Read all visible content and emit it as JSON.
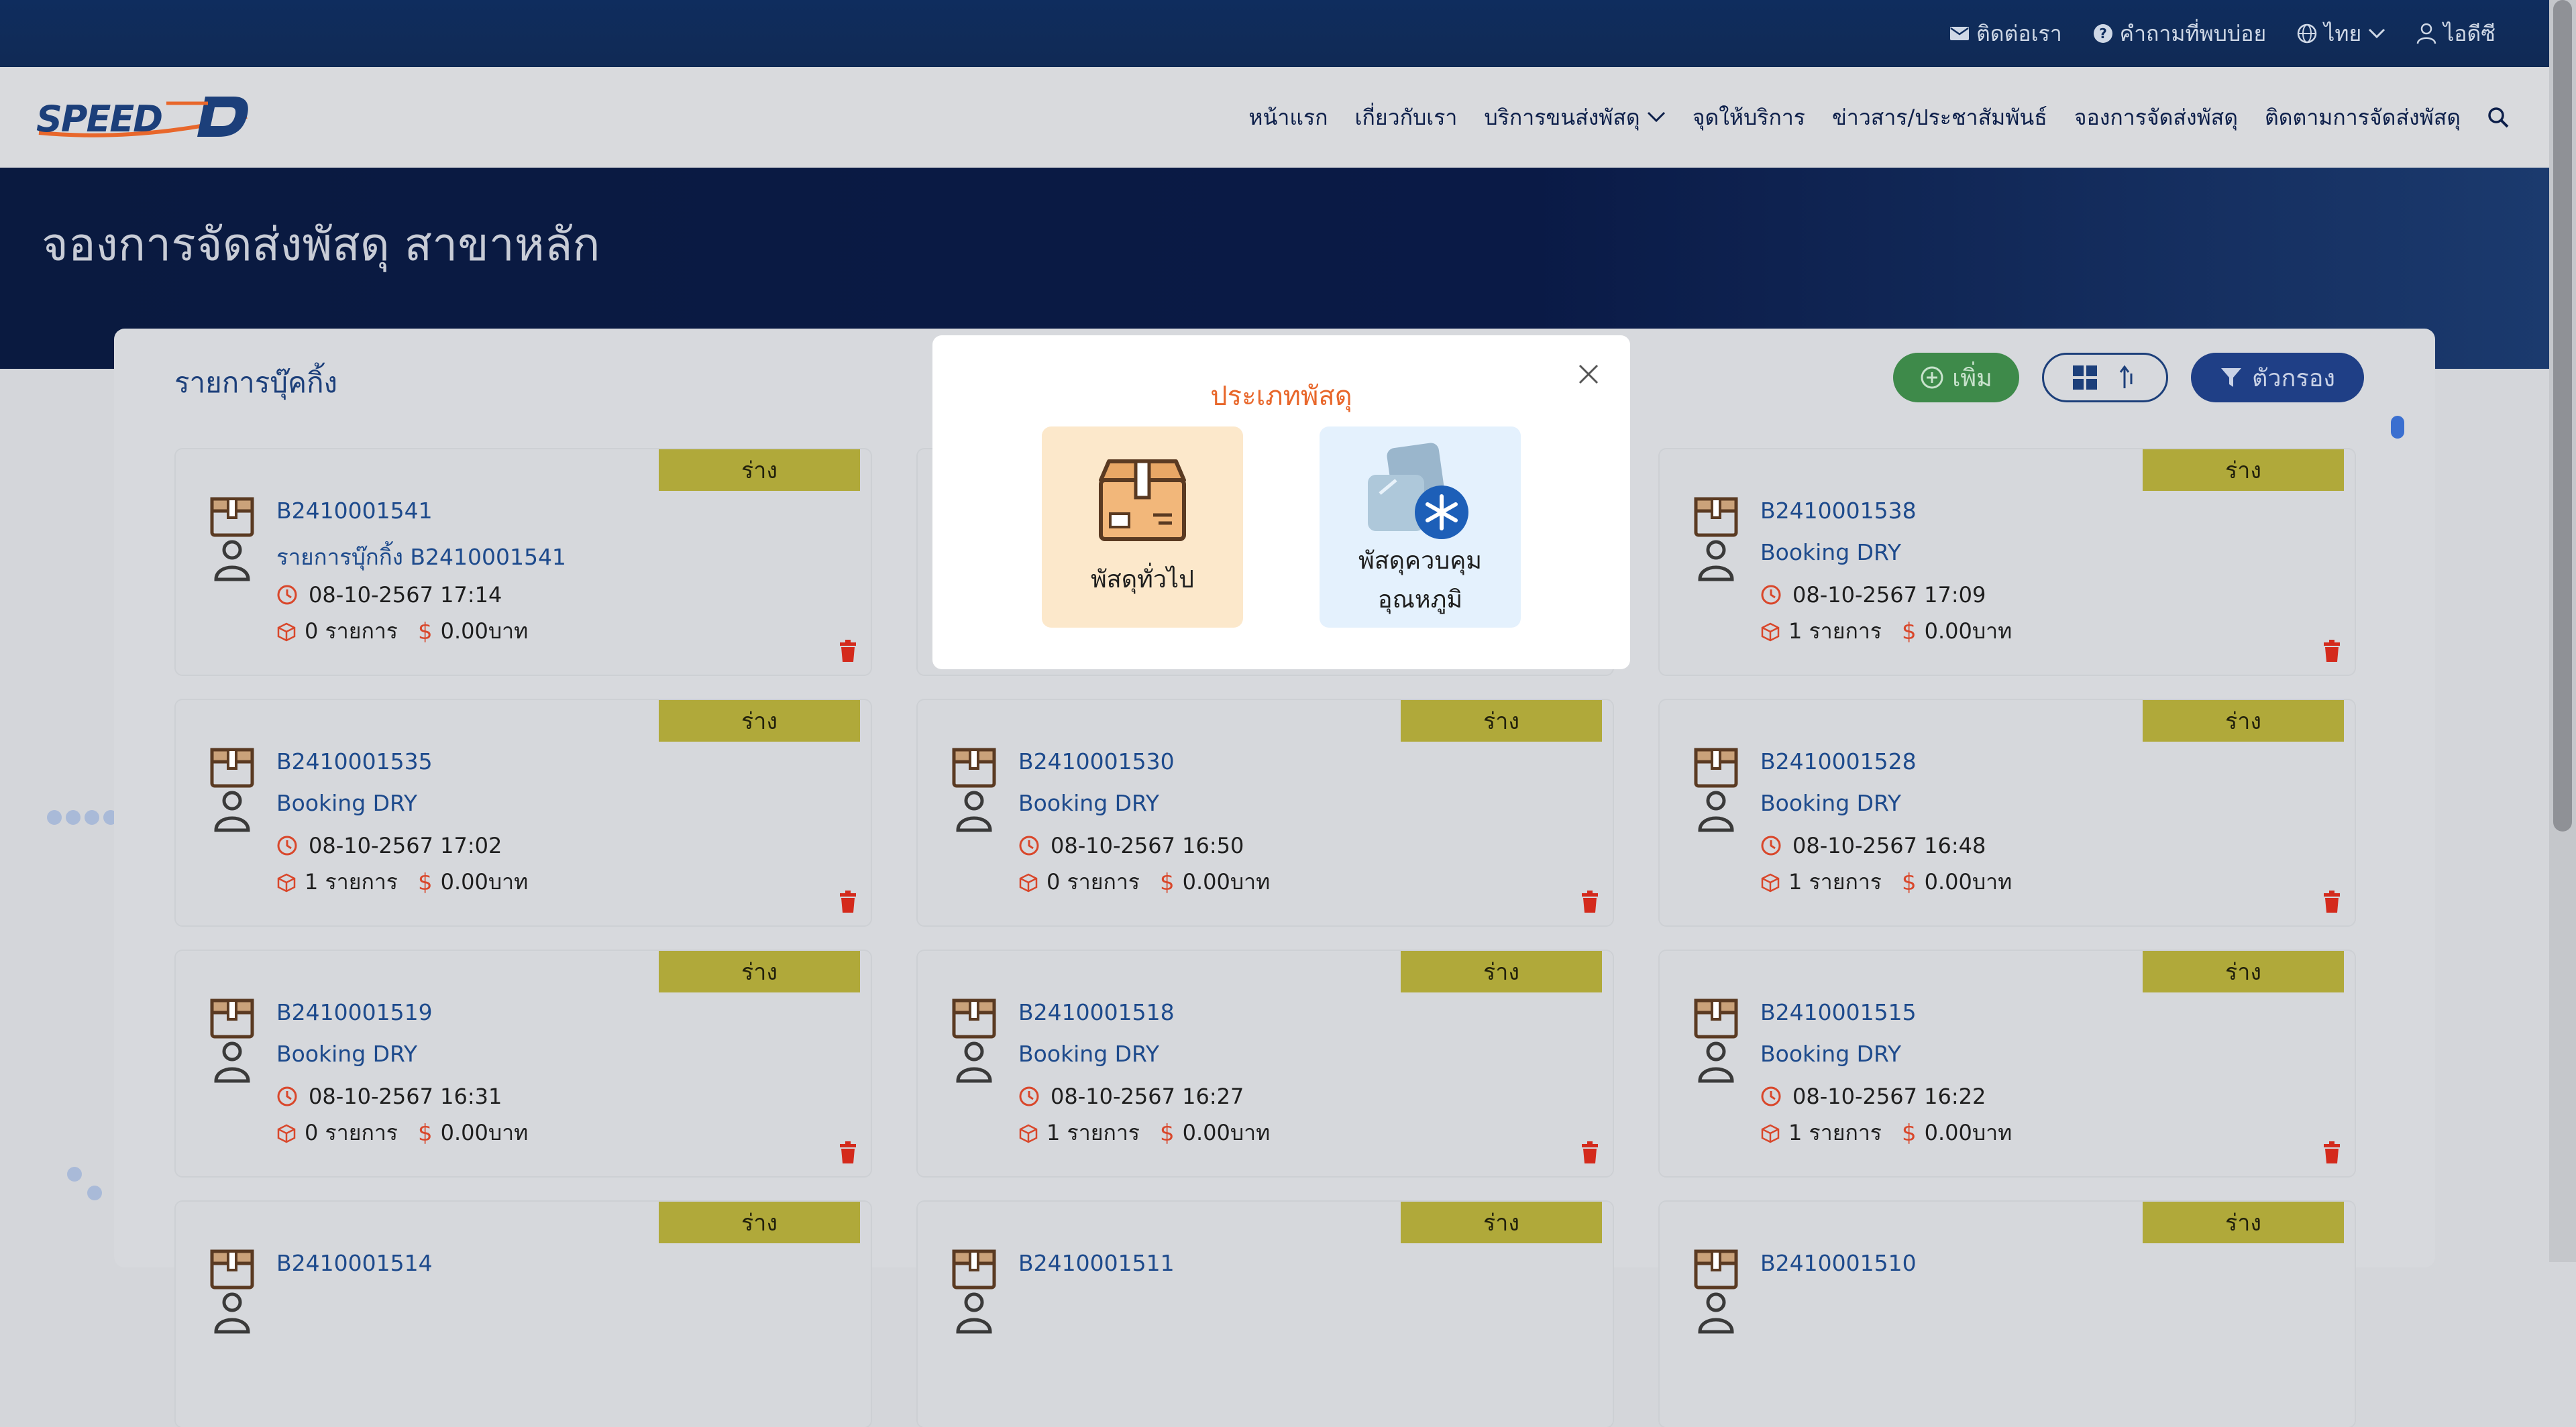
{
  "topbar": {
    "contact": "ติดต่อเรา",
    "faq": "คำถามที่พบบ่อย",
    "language": "ไทย",
    "user": "ไอดีซี"
  },
  "nav": {
    "items": [
      "หน้าแรก",
      "เกี่ยวกับเรา",
      "บริการขนส่งพัสดุ",
      "จุดให้บริการ",
      "ข่าวสาร/ประชาสัมพันธ์",
      "จองการจัดส่งพัสดุ",
      "ติดตามการจัดส่งพัสดุ"
    ]
  },
  "hero": {
    "title": "จองการจัดส่งพัสดุ สาขาหลัก"
  },
  "panel": {
    "title": "รายการบุ๊คกิ้ง",
    "add_label": "เพิ่ม",
    "filter_label": "ตัวกรอง"
  },
  "cards": [
    {
      "badge": "ร่าง",
      "id": "B2410001541",
      "sub": "รายการบุ๊กกิ้ง B2410001541",
      "date": "08-10-2567 17:14",
      "count": "0 รายการ",
      "price": "0.00บาท"
    },
    {
      "badge": "",
      "id": "",
      "sub": "",
      "date": "",
      "count": "",
      "price": ""
    },
    {
      "badge": "ร่าง",
      "id": "B2410001538",
      "sub": "Booking DRY",
      "date": "08-10-2567 17:09",
      "count": "1 รายการ",
      "price": "0.00บาท"
    },
    {
      "badge": "ร่าง",
      "id": "B2410001535",
      "sub": "Booking DRY",
      "date": "08-10-2567 17:02",
      "count": "1 รายการ",
      "price": "0.00บาท"
    },
    {
      "badge": "ร่าง",
      "id": "B2410001530",
      "sub": "Booking DRY",
      "date": "08-10-2567 16:50",
      "count": "0 รายการ",
      "price": "0.00บาท"
    },
    {
      "badge": "ร่าง",
      "id": "B2410001528",
      "sub": "Booking DRY",
      "date": "08-10-2567 16:48",
      "count": "1 รายการ",
      "price": "0.00บาท"
    },
    {
      "badge": "ร่าง",
      "id": "B2410001519",
      "sub": "Booking DRY",
      "date": "08-10-2567 16:31",
      "count": "0 รายการ",
      "price": "0.00บาท"
    },
    {
      "badge": "ร่าง",
      "id": "B2410001518",
      "sub": "Booking DRY",
      "date": "08-10-2567 16:27",
      "count": "1 รายการ",
      "price": "0.00บาท"
    },
    {
      "badge": "ร่าง",
      "id": "B2410001515",
      "sub": "Booking DRY",
      "date": "08-10-2567 16:22",
      "count": "1 รายการ",
      "price": "0.00บาท"
    },
    {
      "badge": "ร่าง",
      "id": "B2410001514",
      "sub": "",
      "date": "",
      "count": "",
      "price": ""
    },
    {
      "badge": "ร่าง",
      "id": "B2410001511",
      "sub": "",
      "date": "",
      "count": "",
      "price": ""
    },
    {
      "badge": "ร่าง",
      "id": "B2410001510",
      "sub": "",
      "date": "",
      "count": "",
      "price": ""
    }
  ],
  "modal": {
    "title": "ประเภทพัสดุ",
    "option_general": "พัสดุทั่วไป",
    "option_cold_line1": "พัสดุควบคุม",
    "option_cold_line2": "อุณหภูมิ"
  },
  "colors": {
    "brand_navy": "#0a1a40",
    "accent_orange": "#e8672b",
    "draft_badge": "#b0a93a",
    "add_green": "#3e8a4a",
    "filter_blue": "#1f3f86"
  }
}
